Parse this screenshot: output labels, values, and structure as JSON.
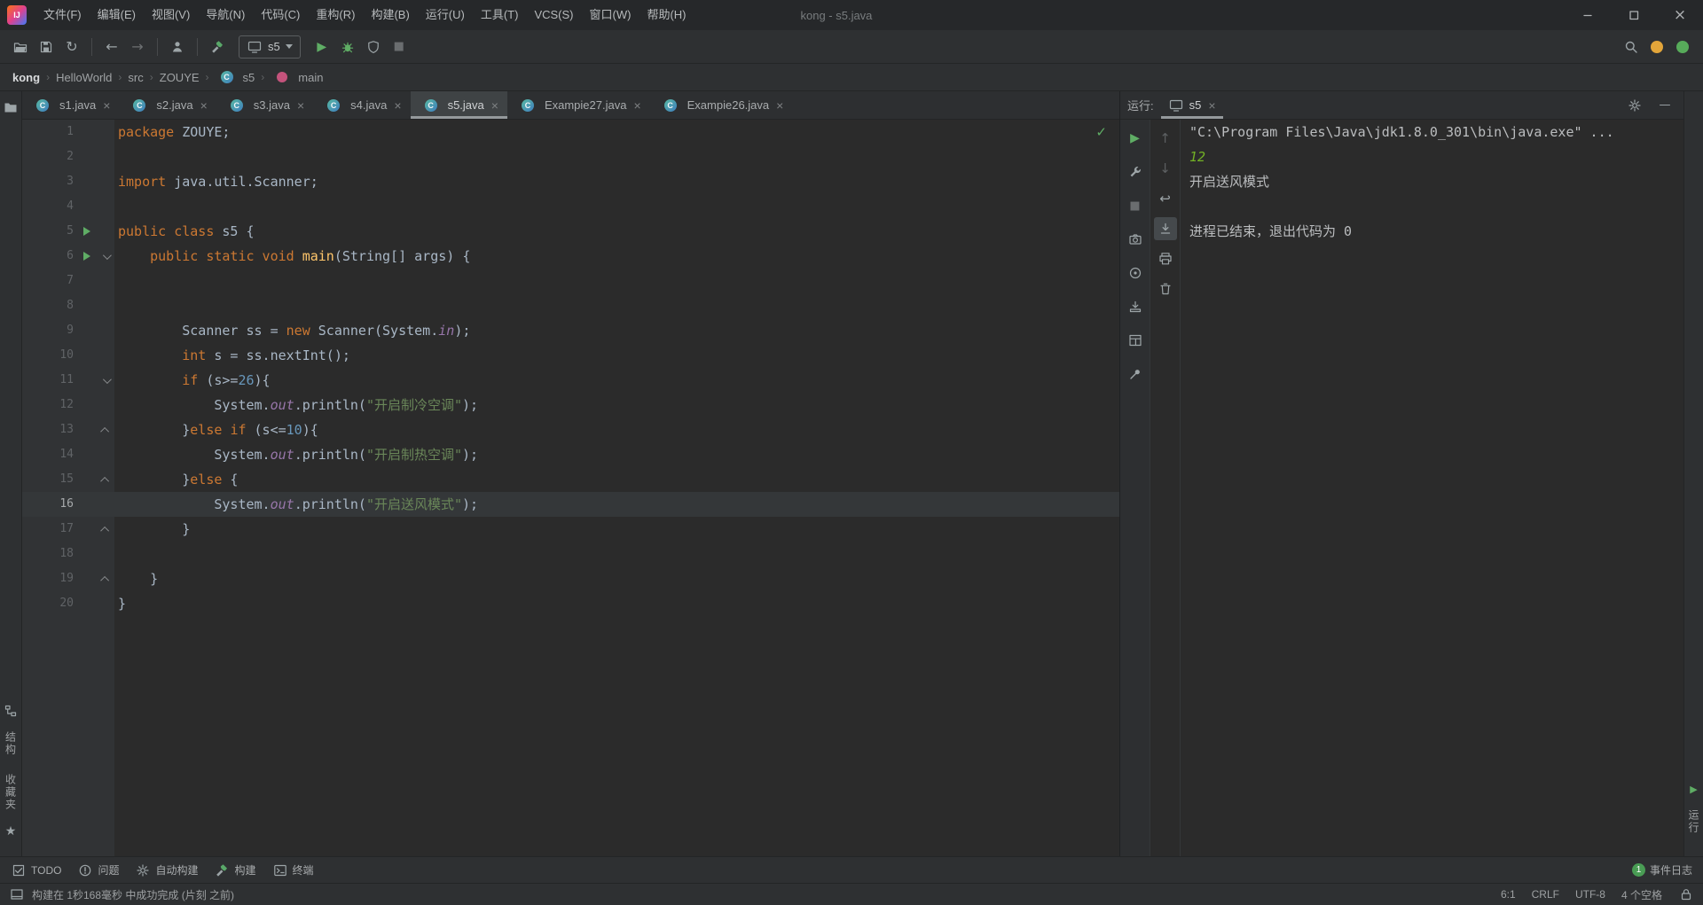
{
  "window": {
    "logo": "IJ",
    "title": "kong - s5.java",
    "menus": [
      "文件(F)",
      "编辑(E)",
      "视图(V)",
      "导航(N)",
      "代码(C)",
      "重构(R)",
      "构建(B)",
      "运行(U)",
      "工具(T)",
      "VCS(S)",
      "窗口(W)",
      "帮助(H)"
    ]
  },
  "toolbar": {
    "groups": [
      [
        "open-folder",
        "save-all",
        "synchronize"
      ],
      [
        "back",
        "forward"
      ],
      [
        "update-project"
      ],
      [
        "build-project"
      ]
    ],
    "run_config": {
      "label": "s5"
    },
    "run_icons": [
      "run",
      "debug",
      "run-with-coverage",
      "stop"
    ],
    "right_icons": [
      "search-everywhere",
      "notification-orange",
      "notification-green"
    ]
  },
  "breadcrumbs": {
    "items": [
      {
        "label": "kong",
        "emphasis": true
      },
      {
        "label": "HelloWorld"
      },
      {
        "label": "src"
      },
      {
        "label": "ZOUYE"
      },
      {
        "label": "s5",
        "icon": "class"
      },
      {
        "label": "main",
        "icon": "method"
      }
    ]
  },
  "left_stripe": {
    "top": [
      {
        "icon": "project-folder"
      }
    ],
    "bottom": [
      {
        "icon": "structure",
        "label": "结构"
      },
      {
        "label": "收藏夹",
        "icon": "star",
        "icon_after": true
      }
    ]
  },
  "right_stripe": {
    "bottom": [
      {
        "icon": "run-stripe",
        "label": "运行"
      }
    ]
  },
  "editor": {
    "tabs": [
      {
        "label": "s1.java"
      },
      {
        "label": "s2.java"
      },
      {
        "label": "s3.java"
      },
      {
        "label": "s4.java"
      },
      {
        "label": "s5.java",
        "active": true
      },
      {
        "label": "Exampie27.java"
      },
      {
        "label": "Exampie26.java"
      }
    ],
    "current_line": 16,
    "gutter_runs": [
      5,
      6
    ],
    "folds": {
      "6": "open",
      "11": "open",
      "13": "close",
      "15": "close",
      "17": "close",
      "19": "close"
    },
    "lines": [
      {
        "n": 1,
        "s": [
          [
            "kw",
            "package"
          ],
          [
            "pl",
            " ZOUYE;"
          ]
        ]
      },
      {
        "n": 2,
        "s": []
      },
      {
        "n": 3,
        "s": [
          [
            "kw",
            "import"
          ],
          [
            "pl",
            " java.util.Scanner;"
          ]
        ]
      },
      {
        "n": 4,
        "s": []
      },
      {
        "n": 5,
        "s": [
          [
            "kw",
            "public class"
          ],
          [
            "pl",
            " s5 {"
          ]
        ]
      },
      {
        "n": 6,
        "s": [
          [
            "pl",
            "    "
          ],
          [
            "kw",
            "public static void"
          ],
          [
            "fn",
            " main"
          ],
          [
            "pl",
            "(String[] args) {"
          ]
        ]
      },
      {
        "n": 7,
        "s": []
      },
      {
        "n": 8,
        "s": []
      },
      {
        "n": 9,
        "s": [
          [
            "pl",
            "        Scanner ss = "
          ],
          [
            "kw",
            "new"
          ],
          [
            "pl",
            " Scanner(System."
          ],
          [
            "fld",
            "in"
          ],
          [
            "pl",
            ");"
          ]
        ]
      },
      {
        "n": 10,
        "s": [
          [
            "pl",
            "        "
          ],
          [
            "kw",
            "int"
          ],
          [
            "pl",
            " s = ss.nextInt();"
          ]
        ]
      },
      {
        "n": 11,
        "s": [
          [
            "pl",
            "        "
          ],
          [
            "kw",
            "if"
          ],
          [
            "pl",
            " (s>="
          ],
          [
            "num",
            "26"
          ],
          [
            "pl",
            "){"
          ]
        ]
      },
      {
        "n": 12,
        "s": [
          [
            "pl",
            "            System."
          ],
          [
            "fld",
            "out"
          ],
          [
            "pl",
            ".println("
          ],
          [
            "str",
            "\"开启制冷空调\""
          ],
          [
            "pl",
            ");"
          ]
        ]
      },
      {
        "n": 13,
        "s": [
          [
            "pl",
            "        }"
          ],
          [
            "kw",
            "else"
          ],
          [
            "pl",
            " "
          ],
          [
            "kw",
            "if"
          ],
          [
            "pl",
            " (s<="
          ],
          [
            "num",
            "10"
          ],
          [
            "pl",
            "){"
          ]
        ]
      },
      {
        "n": 14,
        "s": [
          [
            "pl",
            "            System."
          ],
          [
            "fld",
            "out"
          ],
          [
            "pl",
            ".println("
          ],
          [
            "str",
            "\"开启制热空调\""
          ],
          [
            "pl",
            ");"
          ]
        ]
      },
      {
        "n": 15,
        "s": [
          [
            "pl",
            "        }"
          ],
          [
            "kw",
            "else"
          ],
          [
            "pl",
            " {"
          ]
        ]
      },
      {
        "n": 16,
        "s": [
          [
            "pl",
            "            System."
          ],
          [
            "fld",
            "out"
          ],
          [
            "pl",
            ".println("
          ],
          [
            "str",
            "\"开启送风模式\""
          ],
          [
            "pl",
            ");"
          ]
        ]
      },
      {
        "n": 17,
        "s": [
          [
            "pl",
            "        }"
          ]
        ]
      },
      {
        "n": 18,
        "s": []
      },
      {
        "n": 19,
        "s": [
          [
            "pl",
            "    }"
          ]
        ]
      },
      {
        "n": 20,
        "s": [
          [
            "pl",
            "}"
          ]
        ]
      }
    ]
  },
  "run_panel": {
    "header_label": "运行:",
    "tab": {
      "label": "s5"
    },
    "left_toolbar": [
      "rerun",
      "edit-configuration",
      "stop",
      "thread-dump",
      "heap-dump",
      "attach-to-process",
      "restore-layout",
      "pin-tab"
    ],
    "console_toolbar": [
      {
        "name": "up-stack"
      },
      {
        "name": "down-stack"
      },
      {
        "name": "soft-wrap"
      },
      {
        "name": "scroll-to-end",
        "active": true
      },
      {
        "name": "print"
      },
      {
        "name": "clear-all"
      }
    ],
    "console": [
      {
        "seg": [
          [
            "txt",
            "\"C:\\Program Files\\Java\\jdk1.8.0_301\\bin\\java.exe\" ..."
          ]
        ]
      },
      {
        "seg": [
          [
            "input",
            "12"
          ]
        ]
      },
      {
        "seg": [
          [
            "txt",
            "开启送风模式"
          ]
        ]
      },
      {
        "seg": []
      },
      {
        "seg": [
          [
            "txt",
            "进程已结束，退出代码为 0"
          ]
        ]
      }
    ]
  },
  "bottom_bar": {
    "items": [
      {
        "icon": "todo",
        "label": "TODO"
      },
      {
        "icon": "problems",
        "label": "问题"
      },
      {
        "icon": "auto-build",
        "label": "自动构建"
      },
      {
        "icon": "build-hammer",
        "label": "构建"
      },
      {
        "icon": "terminal",
        "label": "终端"
      }
    ],
    "event_log": {
      "label": "事件日志",
      "badge": "1"
    }
  },
  "status_bar": {
    "message": "构建在 1秒168毫秒 中成功完成 (片刻 之前)",
    "caret": "6:1",
    "line_separator": "CRLF",
    "encoding": "UTF-8",
    "indent": "4 个空格"
  },
  "palette": {
    "keyword": "#cc7832",
    "plain": "#a9b7c6",
    "string": "#6a8759",
    "number": "#6897bb",
    "field": "#9876aa",
    "function": "#ffc66b",
    "console_text": "#bbbdbf",
    "console_input": "#72b025",
    "run_green": "#5fad65",
    "accent_underline": "#94999c"
  }
}
